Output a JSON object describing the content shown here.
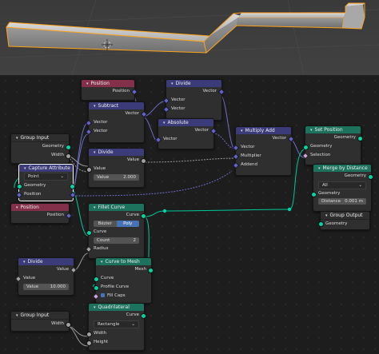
{
  "colors": {
    "input_header": "#83314a",
    "vector_header": "#3b3b7a",
    "geometry_header": "#1d725e",
    "geometry_socket": "#00d6a3",
    "vector_socket": "#6363c7",
    "float_socket": "#a1a1a1",
    "selection": "#ffa21a"
  },
  "nodes": {
    "position1": {
      "title": "Position",
      "out": "Position"
    },
    "divide_vec": {
      "title": "Divide",
      "out": "Vector",
      "in1": "Vector",
      "in2": "Vector"
    },
    "subtract": {
      "title": "Subtract",
      "out": "Vector",
      "in1": "Vector",
      "in2": "Vector"
    },
    "absolute": {
      "title": "Absolute",
      "out": "Vector",
      "in1": "Vector"
    },
    "multiply_add": {
      "title": "Multiply Add",
      "out": "Vector",
      "in1": "Vector",
      "in2": "Multiplier",
      "in3": "Addend"
    },
    "set_position": {
      "title": "Set Position",
      "out": "Geometry",
      "in1": "Geometry",
      "in2": "Selection",
      "in3": "Position",
      "in4": "Offset"
    },
    "group_input1": {
      "title": "Group Input",
      "out1": "Geometry",
      "out2": "Width"
    },
    "divide_flt": {
      "title": "Divide",
      "out": "Value",
      "in1": "Value",
      "field_label": "Value",
      "field_value": "2.000"
    },
    "capture": {
      "title": "Capture Attribute",
      "domain": "Point",
      "in1": "Geometry",
      "in2": "Position"
    },
    "merge": {
      "title": "Merge by Distance",
      "out": "Geometry",
      "mode": "All",
      "in1": "Geometry",
      "in2": "Selection",
      "field_label": "Distance",
      "field_value": "0.001 m"
    },
    "group_output": {
      "title": "Group Output",
      "in1": "Geometry"
    },
    "position2": {
      "title": "Position",
      "out": "Position"
    },
    "fillet": {
      "title": "Fillet Curve",
      "out": "Curve",
      "opt1": "Bézier",
      "opt2": "Poly",
      "in1": "Curve",
      "count_label": "Count",
      "count_value": "2",
      "in2": "Radius"
    },
    "divide3": {
      "title": "Divide",
      "out": "Value",
      "in1": "Value",
      "field_label": "Value",
      "field_value": "10.000"
    },
    "curve_to_mesh": {
      "title": "Curve to Mesh",
      "out": "Mesh",
      "in1": "Curve",
      "in2": "Profile Curve",
      "in3": "Fill Caps"
    },
    "group_input2": {
      "title": "Group Input",
      "out": "Width"
    },
    "quadrilateral": {
      "title": "Quadrilateral",
      "out": "Curve",
      "mode": "Rectangle",
      "in1": "Width",
      "in2": "Height"
    }
  }
}
